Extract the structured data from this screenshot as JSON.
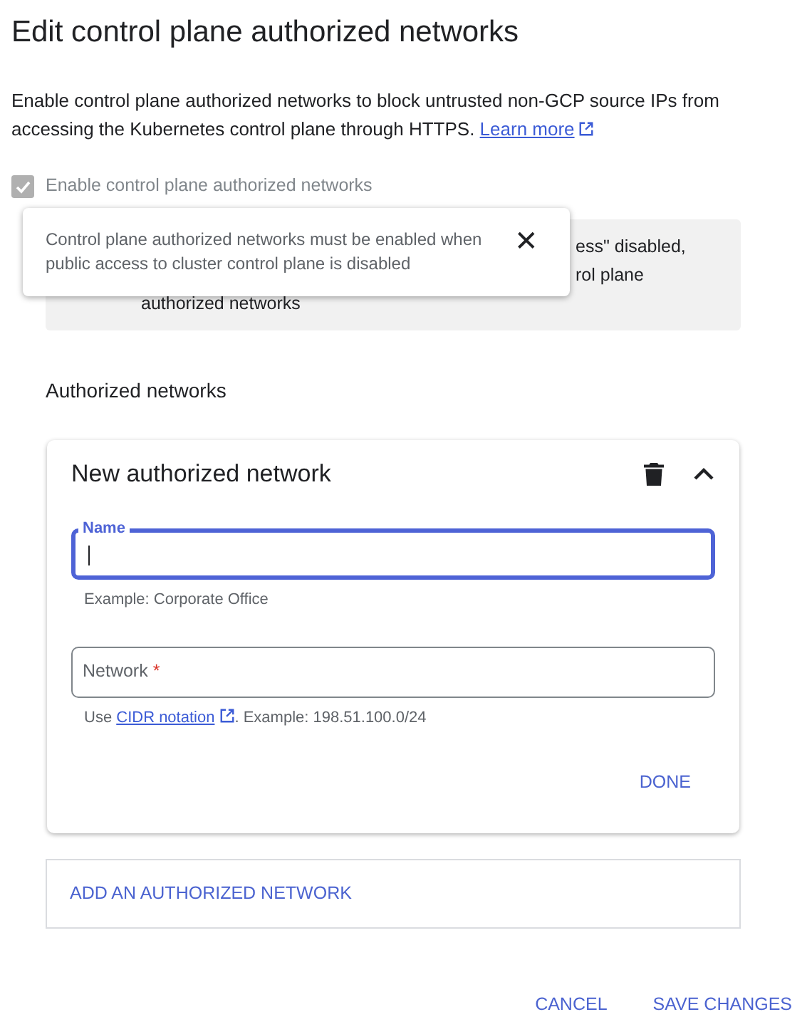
{
  "title": "Edit control plane authorized networks",
  "description": {
    "text": "Enable control plane authorized networks to block untrusted non-GCP source IPs from accessing the Kubernetes control plane through HTTPS.",
    "link": "Learn more"
  },
  "enable_checkbox": {
    "label": "Enable control plane authorized networks",
    "checked": true,
    "disabled": true
  },
  "info_box": {
    "visible_lines": [
      "ess\" disabled,",
      "rol plane",
      "authorized networks"
    ]
  },
  "tooltip": {
    "text": "Control plane authorized networks must be enabled when public access to cluster control plane is disabled",
    "close": "✕"
  },
  "section_title": "Authorized networks",
  "network_card": {
    "title": "New authorized network",
    "expanded": true,
    "fields": [
      {
        "label": "Name",
        "focused": true,
        "hint": "Example: Corporate Office"
      },
      {
        "label": "Network",
        "required_mark": "*",
        "focused": false,
        "hint_before": "Use",
        "hint_link": "CIDR notation",
        "hint_after": ". Example: 198.51.100.0/24"
      }
    ],
    "done": "DONE"
  },
  "add_button": "ADD AN AUTHORIZED NETWORK",
  "footer_buttons": [
    "CANCEL",
    "SAVE CHANGES"
  ]
}
